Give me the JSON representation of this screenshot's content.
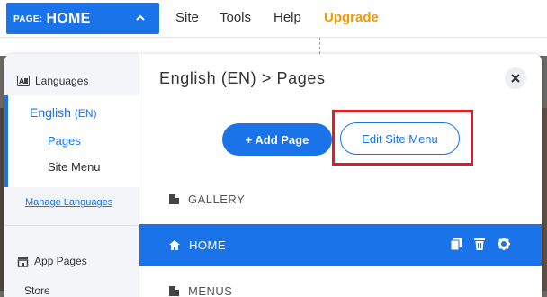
{
  "topbar": {
    "page_prefix": "PAGE:",
    "page_name": "HOME",
    "nav": [
      "Site",
      "Tools",
      "Help"
    ],
    "upgrade": "Upgrade"
  },
  "sidebar": {
    "languages_heading": "Languages",
    "current_language": "English",
    "current_language_code": "(EN)",
    "sub_items": [
      "Pages",
      "Site Menu"
    ],
    "manage_link": "Manage Languages",
    "app_pages_heading": "App Pages",
    "store_item": "Store"
  },
  "main": {
    "breadcrumb": "English (EN) > Pages",
    "add_page_label": "+ Add Page",
    "edit_menu_label": "Edit Site Menu",
    "pages": [
      {
        "name": "GALLERY",
        "icon": "page-icon",
        "active": false
      },
      {
        "name": "HOME",
        "icon": "home-icon",
        "active": true
      },
      {
        "name": "MENUS",
        "icon": "page-icon",
        "active": false
      }
    ]
  },
  "colors": {
    "accent": "#1a73e8",
    "upgrade": "#f29900",
    "highlight": "#e31b23"
  }
}
